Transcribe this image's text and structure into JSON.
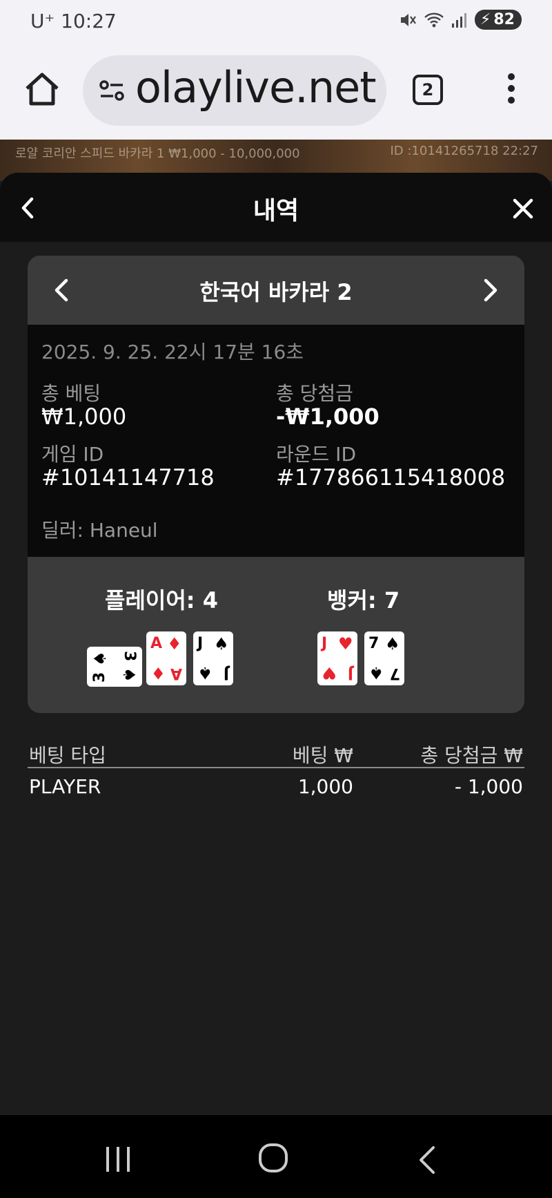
{
  "status": {
    "carrier_time": "U⁺ 10:27",
    "battery": "82"
  },
  "browser": {
    "url": "olaylive.net",
    "tab_count": "2"
  },
  "game_strip": {
    "left": "로얄 코리안 스피드 바카라 1 ₩1,000 - 10,000,000",
    "right": "ID :10141265718 22:27"
  },
  "sheet": {
    "title": "내역"
  },
  "game": {
    "name": "한국어 바카라 2",
    "datetime": "2025. 9. 25. 22시 17분 16초",
    "total_bet_label": "총 베팅",
    "total_bet_value": "₩1,000",
    "total_win_label": "총 당첨금",
    "total_win_value": "-₩1,000",
    "game_id_label": "게임 ID",
    "game_id_value": "#10141147718",
    "round_id_label": "라운드 ID",
    "round_id_value": "#177866115418008",
    "dealer": "딜러: Haneul"
  },
  "result": {
    "player_label": "플레이어: 4",
    "banker_label": "뱅커: 7",
    "player_cards": [
      {
        "rank": "3",
        "suit": "♠",
        "color": "#000000",
        "sideways": true
      },
      {
        "rank": "A",
        "suit": "♦",
        "color": "#e8232e",
        "sideways": false
      },
      {
        "rank": "J",
        "suit": "♠",
        "color": "#000000",
        "sideways": false
      }
    ],
    "banker_cards": [
      {
        "rank": "J",
        "suit": "♥",
        "color": "#e8232e",
        "sideways": false
      },
      {
        "rank": "7",
        "suit": "♠",
        "color": "#000000",
        "sideways": false
      }
    ]
  },
  "bets": {
    "headers": [
      "베팅 타입",
      "베팅 ₩",
      "총 당첨금 ₩"
    ],
    "rows": [
      {
        "type": "PLAYER",
        "bet": "1,000",
        "win": "- 1,000"
      }
    ]
  }
}
